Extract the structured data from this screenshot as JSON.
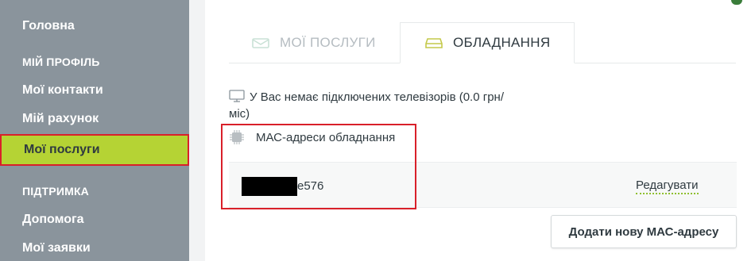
{
  "sidebar": {
    "home": "Головна",
    "profile_section": "МІЙ ПРОФІЛЬ",
    "contacts": "Мої контакти",
    "account": "Мій рахунок",
    "services": "Мої послуги",
    "support_section": "ПІДТРИМКА",
    "help": "Допомога",
    "requests": "Мої заявки"
  },
  "tabs": {
    "services": "МОЇ ПОСЛУГИ",
    "equipment": "ОБЛАДНАННЯ"
  },
  "equipment": {
    "tv_message": "У Вас немає підключених телевізорів (0.0 грн/міс)",
    "mac_title": "МАС-адреси обладнання",
    "mac_value": "e576",
    "edit_label": "Редагувати",
    "add_button": "Додати нову МАС-адресу"
  },
  "colors": {
    "sidebar_bg": "#8a949c",
    "active_bg": "#b5d334",
    "highlight": "#d9202a"
  }
}
